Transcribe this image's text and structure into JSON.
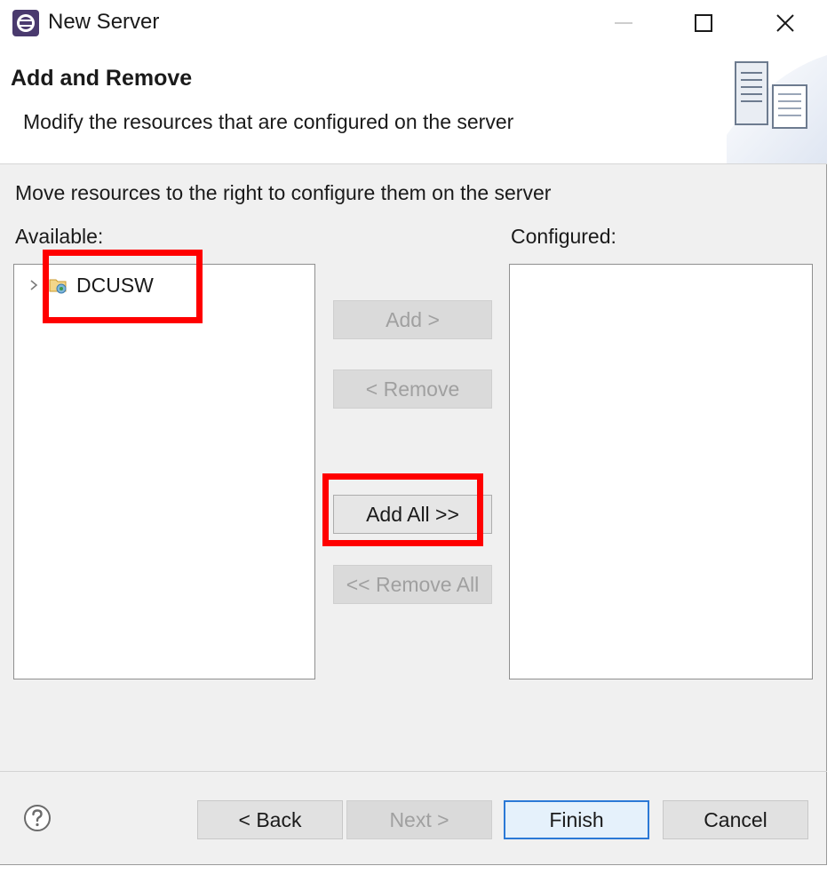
{
  "window": {
    "title": "New Server",
    "icon": "eclipse-server-icon"
  },
  "header": {
    "title": "Add and Remove",
    "description": "Modify the resources that are configured on the server",
    "banner_icon": "server-wizard-banner-icon"
  },
  "body": {
    "instruction": "Move resources to the right to configure them on the server",
    "available_label": "Available:",
    "configured_label": "Configured:",
    "available_items": [
      {
        "label": "DCUSW",
        "icon": "web-project-icon",
        "expanded": false
      }
    ],
    "configured_items": []
  },
  "transfer_buttons": {
    "add": "Add >",
    "remove": "< Remove",
    "add_all": "Add All >>",
    "remove_all": "<< Remove All"
  },
  "footer": {
    "back": "< Back",
    "next": "Next >",
    "finish": "Finish",
    "cancel": "Cancel"
  },
  "colors": {
    "highlight": "#ff0000",
    "default_button_border": "#2b79d6"
  }
}
